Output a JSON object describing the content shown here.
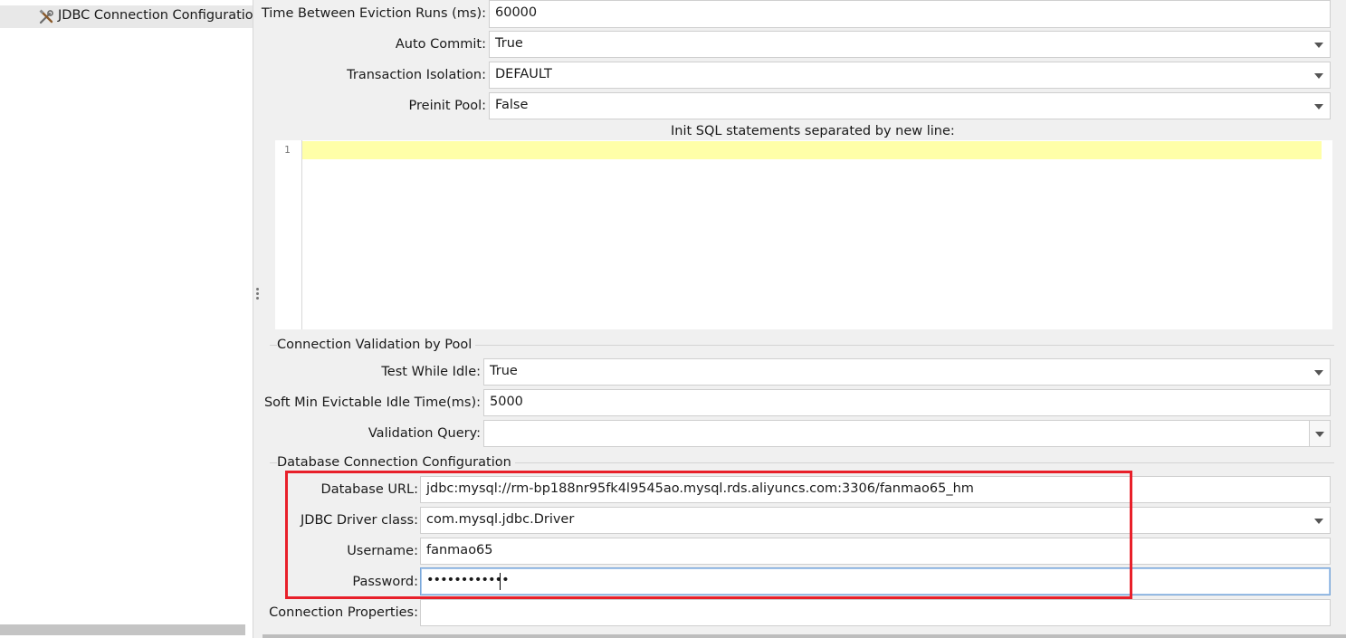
{
  "tree": {
    "item_label": "JDBC Connection Configuration",
    "icon": "tools-icon"
  },
  "pool": {
    "eviction_label": "Time Between Eviction Runs (ms):",
    "eviction_value": "60000",
    "auto_commit_label": "Auto Commit:",
    "auto_commit_value": "True",
    "isolation_label": "Transaction Isolation:",
    "isolation_value": "DEFAULT",
    "preinit_label": "Preinit Pool:",
    "preinit_value": "False",
    "init_sql_label": "Init SQL statements separated by new line:",
    "init_sql_line_number": "1"
  },
  "validation": {
    "section_title": "Connection Validation by Pool",
    "test_idle_label": "Test While Idle:",
    "test_idle_value": "True",
    "soft_min_label": "Soft Min Evictable Idle Time(ms):",
    "soft_min_value": "5000",
    "query_label": "Validation Query:",
    "query_value": ""
  },
  "database": {
    "section_title": "Database Connection Configuration",
    "url_label": "Database URL:",
    "url_value": "jdbc:mysql://rm-bp188nr95fk4l9545ao.mysql.rds.aliyuncs.com:3306/fanmao65_hm",
    "driver_label": "JDBC Driver class:",
    "driver_value": "com.mysql.jdbc.Driver",
    "username_label": "Username:",
    "username_value": "fanmao65",
    "password_label": "Password:",
    "password_value": "••••••••••••",
    "properties_label": "Connection Properties:",
    "properties_value": ""
  },
  "colors": {
    "highlight_box": "#e8202a",
    "current_line": "#ffff99",
    "focus_border": "#7aa7d8"
  }
}
